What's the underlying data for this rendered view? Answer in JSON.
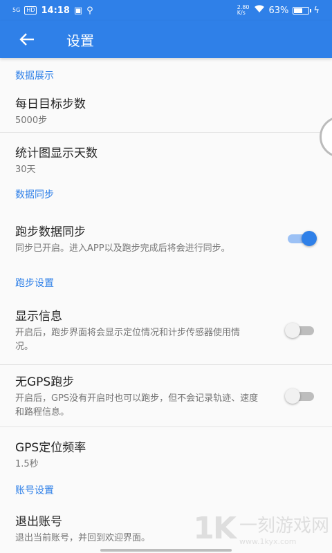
{
  "status_bar": {
    "signal_label": "5G",
    "hd_label": "HD",
    "time": "14:18",
    "speed_top": "2.80",
    "speed_bottom": "K/s",
    "battery_percent": "63%",
    "battery_level": 0.63
  },
  "app_bar": {
    "title": "设置"
  },
  "sections": {
    "data_display": {
      "header": "数据展示",
      "daily_goal": {
        "title": "每日目标步数",
        "value": "5000步"
      },
      "chart_days": {
        "title": "统计图显示天数",
        "value": "30天"
      }
    },
    "data_sync": {
      "header": "数据同步",
      "run_sync": {
        "title": "跑步数据同步",
        "desc": "同步已开启。进入APP以及跑步完成后将会进行同步。",
        "enabled": true
      }
    },
    "run_settings": {
      "header": "跑步设置",
      "show_info": {
        "title": "显示信息",
        "desc": "开启后，跑步界面将会显示定位情况和计步传感器使用情况。",
        "enabled": false
      },
      "no_gps": {
        "title": "无GPS跑步",
        "desc": "开启后，GPS没有开启时也可以跑步，但不会记录轨迹、速度和路程信息。",
        "enabled": false
      },
      "gps_freq": {
        "title": "GPS定位频率",
        "value": "1.5秒"
      }
    },
    "account": {
      "header": "账号设置",
      "logout": {
        "title": "退出账号",
        "desc": "退出当前账号，并回到欢迎界面。"
      }
    }
  },
  "watermark": {
    "cn": "一刻游戏网",
    "url": "www.1kyx.com"
  },
  "colors": {
    "primary": "#2f80e8",
    "switch_on_track": "#9cc1f5"
  }
}
